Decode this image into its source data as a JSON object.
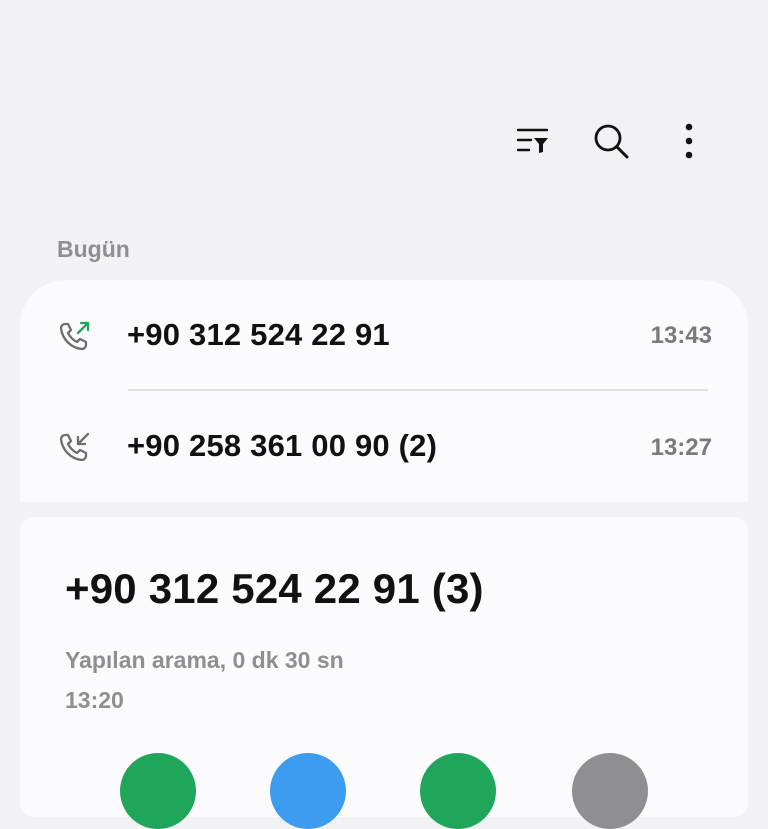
{
  "toolbar": {
    "icons": [
      "filter-sort-icon",
      "search-icon",
      "more-options-icon"
    ]
  },
  "section": {
    "header": "Bugün"
  },
  "call_log": [
    {
      "number": "+90 312 524 22 91",
      "time": "13:43",
      "direction": "outgoing",
      "icon": "outgoing-call-icon",
      "arrow_color": "#1fa65a"
    },
    {
      "number": "+90 258 361 00 90 (2)",
      "time": "13:27",
      "direction": "incoming",
      "icon": "incoming-call-icon",
      "arrow_color": "#6e6e72"
    }
  ],
  "detail": {
    "number": "+90 312 524 22 91 (3)",
    "description": "Yapılan arama, 0 dk 30 sn",
    "time": "13:20",
    "actions": [
      {
        "name": "call-button",
        "color": "#1fa65a"
      },
      {
        "name": "message-button",
        "color": "#3d9cf0"
      },
      {
        "name": "video-call-button",
        "color": "#1fa65a"
      },
      {
        "name": "info-button",
        "color": "#8e8e93"
      }
    ]
  },
  "colors": {
    "background": "#f2f2f4",
    "card": "#fbfbfd",
    "secondary_text": "#8e8e93"
  }
}
